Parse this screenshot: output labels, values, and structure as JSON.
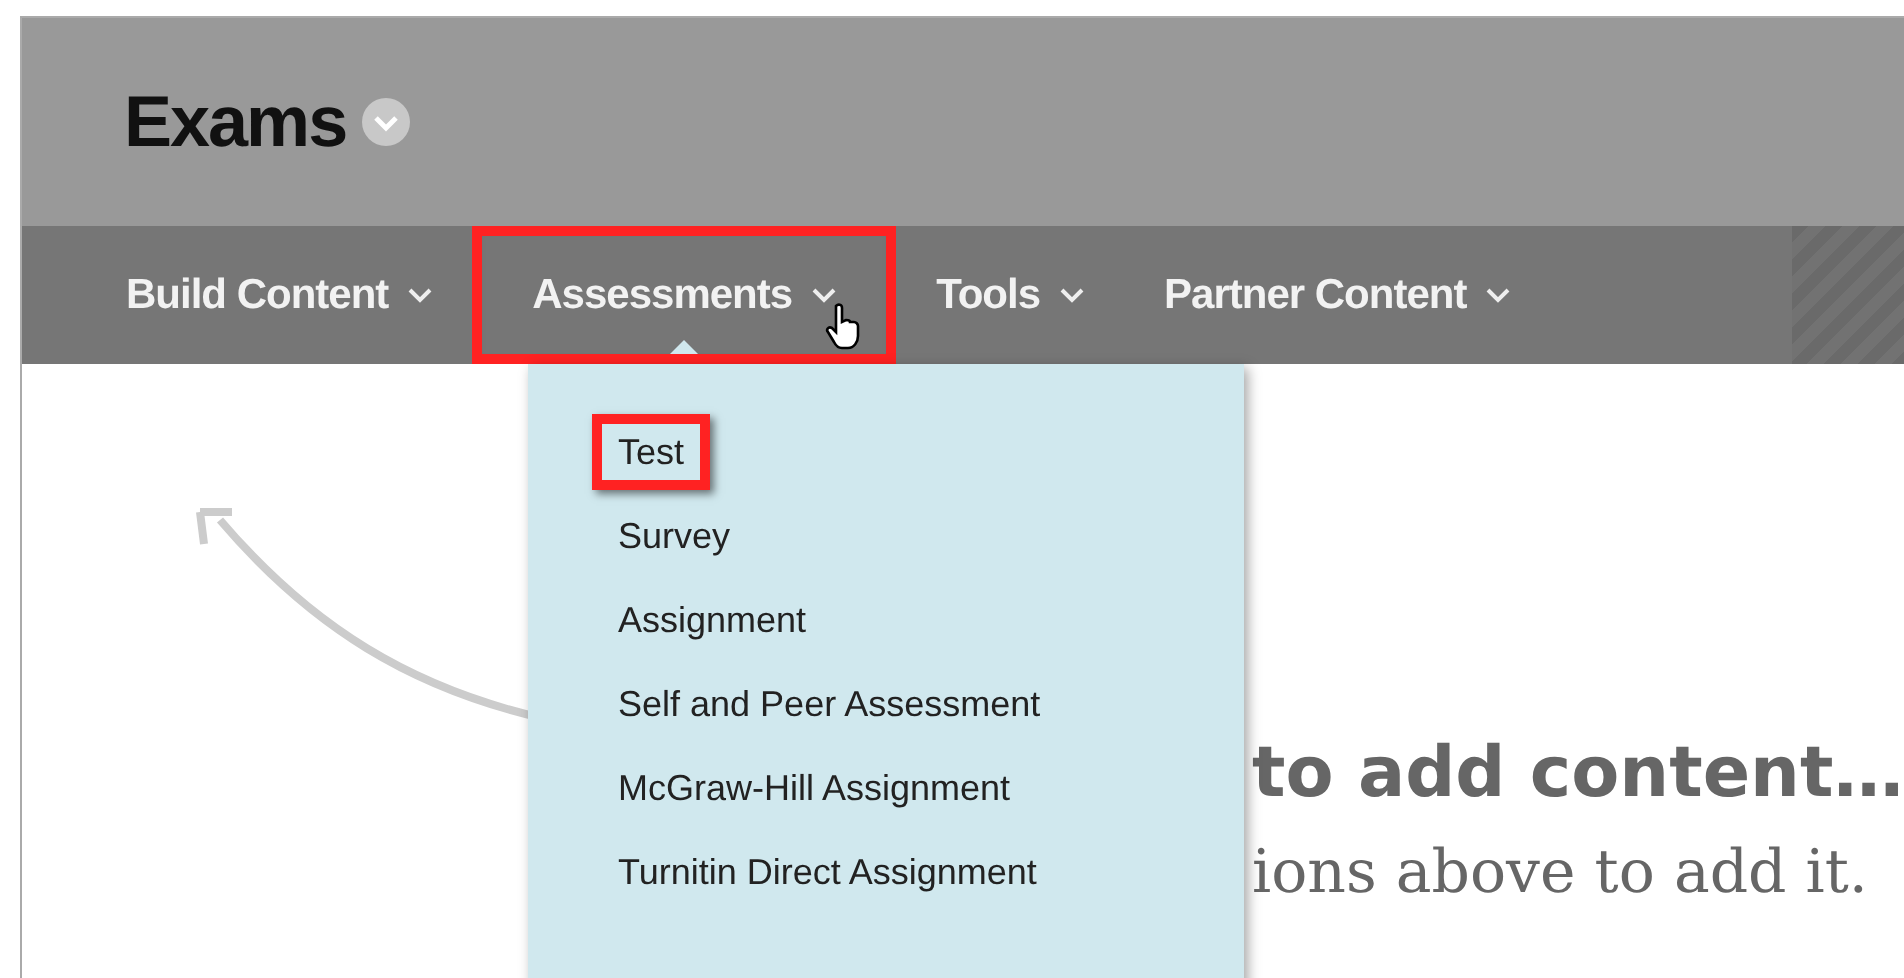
{
  "page": {
    "title": "Exams"
  },
  "nav": [
    {
      "label": "Build Content",
      "selected": false,
      "highlighted": false
    },
    {
      "label": "Assessments",
      "selected": true,
      "highlighted": true
    },
    {
      "label": "Tools",
      "selected": false,
      "highlighted": false
    },
    {
      "label": "Partner Content",
      "selected": false,
      "highlighted": false
    }
  ],
  "menu": [
    {
      "label": "Test",
      "highlighted": true
    },
    {
      "label": "Survey",
      "highlighted": false
    },
    {
      "label": "Assignment",
      "highlighted": false
    },
    {
      "label": "Self and Peer Assessment",
      "highlighted": false
    },
    {
      "label": "McGraw-Hill Assignment",
      "highlighted": false
    },
    {
      "label": "Turnitin Direct Assignment",
      "highlighted": false
    }
  ],
  "empty_state": {
    "heading": "to add content…",
    "text": "ions above to add it."
  }
}
